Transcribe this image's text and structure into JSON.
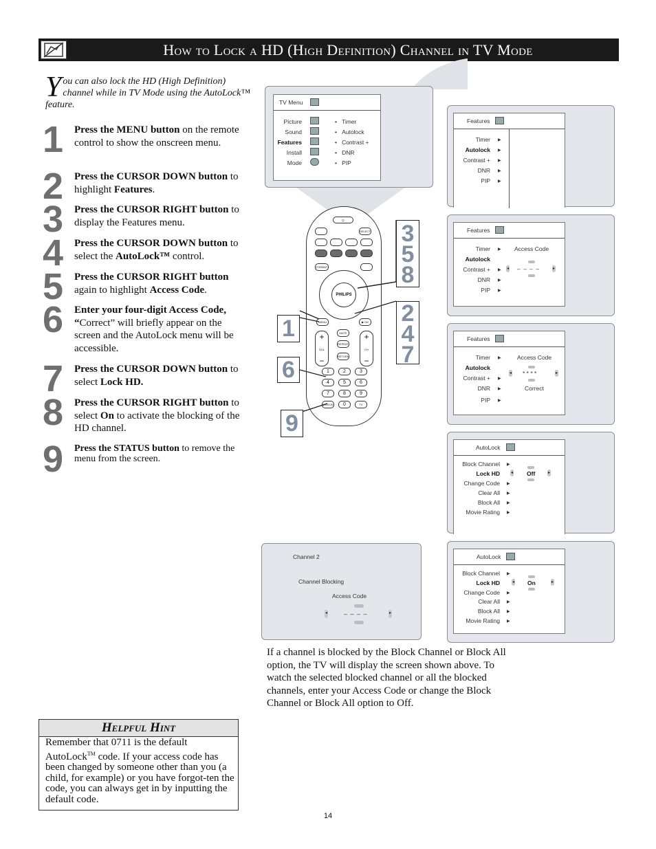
{
  "header": {
    "title": "How to Lock a HD (High Definition) Channel in TV Mode",
    "icon": "hand-pencil-icon"
  },
  "intro": {
    "dropcap": "Y",
    "text": "ou can also lock the HD (High Definition) channel while in TV Mode using the AutoLock™ feature."
  },
  "steps": [
    {
      "num": "1",
      "bold": "Press the MENU button",
      "rest": " on the remote control to show the onscreen menu."
    },
    {
      "num": "2",
      "bold": "Press the CURSOR DOWN button",
      "rest": " to highlight ",
      "bold2": "Features",
      "rest2": "."
    },
    {
      "num": "3",
      "bold": "Press the CURSOR RIGHT button",
      "rest": " to display the Features menu."
    },
    {
      "num": "4",
      "bold": "Press the CURSOR DOWN button",
      "rest": " to select the ",
      "bold2": "AutoLock™",
      "rest2": " control."
    },
    {
      "num": "5",
      "bold": "Press the CURSOR RIGHT button",
      "rest": " again to highlight ",
      "bold2": "Access Code",
      "rest2": "."
    },
    {
      "num": "6",
      "bold": "Enter your four-digit Access Code, “",
      "rest": "Correct” will briefly appear on the screen and the AutoLock menu will be accessible."
    },
    {
      "num": "7",
      "bold": "Press the CURSOR DOWN button",
      "rest": " to select ",
      "bold2": "Lock HD.",
      "rest2": ""
    },
    {
      "num": "8",
      "bold": "Press the CURSOR RIGHT button",
      "rest": " to select ",
      "bold2": "On",
      "rest2": " to activate the blocking of the HD channel."
    },
    {
      "num": "9",
      "bold": "Press the STATUS button",
      "rest": " to remove the menu from the screen."
    }
  ],
  "screens": {
    "tv_menu": {
      "title": "TV Menu",
      "items": [
        "Picture",
        "Sound",
        "Features",
        "Install",
        "Mode"
      ],
      "selected": "Features",
      "subitems": [
        "Timer",
        "Autolock",
        "Contrast +",
        "DNR",
        "PIP"
      ]
    },
    "features1": {
      "title": "Features",
      "items": [
        "Timer",
        "Autolock",
        "Contrast +",
        "DNR",
        "PIP"
      ],
      "selected": "Autolock"
    },
    "features2": {
      "title": "Features",
      "items": [
        "Timer",
        "Autolock",
        "Contrast +",
        "DNR",
        "PIP"
      ],
      "selected": "Autolock",
      "field_label": "Access Code",
      "field_value": "– – – –"
    },
    "features3": {
      "title": "Features",
      "items": [
        "Timer",
        "Autolock",
        "Contrast +",
        "DNR",
        "PIP"
      ],
      "selected": "Autolock",
      "field_label": "Access Code",
      "field_value": "* * * *",
      "status": "Correct"
    },
    "autolock_off": {
      "title": "AutoLock",
      "items": [
        "Block Channel",
        "Lock HD",
        "Change Code",
        "Clear All",
        "Block All",
        "Movie Rating"
      ],
      "selected": "Lock HD",
      "value": "Off"
    },
    "autolock_on": {
      "title": "AutoLock",
      "items": [
        "Block Channel",
        "Lock HD",
        "Change Code",
        "Clear All",
        "Block All",
        "Movie Rating"
      ],
      "selected": "Lock HD",
      "value": "On"
    },
    "blocked": {
      "channel": "Channel 2",
      "heading": "Channel Blocking",
      "field_label": "Access Code",
      "field_value": "– – – –"
    }
  },
  "remote": {
    "brand": "PHILIPS",
    "callouts": {
      "menu": "1",
      "nav_up_right": "3\n5\n8",
      "nav_down": "2\n4\n7",
      "digits": "6",
      "status": "9"
    },
    "buttons": {
      "menu": "MENU",
      "ok": "▶ OK",
      "mute": "MUTE",
      "repeat": "REPEAT",
      "return": "RETURN",
      "vol": "VOL",
      "ch": "CH",
      "select": "SELECT",
      "format": "FORMAT",
      "status": "STATUS",
      "tv": "TV",
      "digits": [
        "1",
        "2",
        "3",
        "4",
        "5",
        "6",
        "7",
        "8",
        "9",
        "0"
      ]
    }
  },
  "caption": "If a channel is blocked by the Block Channel or Block All option, the TV will display the screen shown above. To watch the selected blocked channel or all the blocked channels, enter your Access Code or change the Block Channel or Block All option to Off.",
  "hint": {
    "title": "Helpful Hint",
    "text_a": "Remember that 0711 is the default AutoLock",
    "tm": "TM",
    "text_b": " code.  If your access code has been changed by someone other than you (a child, for example) or you have forgot-ten the code, you can always get in by inputting the default code."
  },
  "page_number": "14"
}
